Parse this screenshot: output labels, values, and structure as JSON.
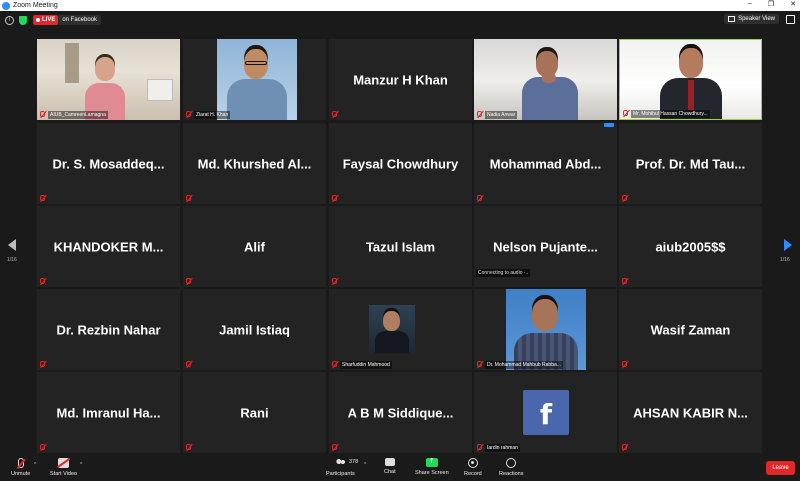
{
  "window": {
    "title": "Zoom Meeting",
    "minimize": "–",
    "maximize": "❐",
    "close": "✕"
  },
  "topbar": {
    "live_label": "LIVE",
    "live_target": "on Facebook",
    "speaker_view": "Speaker View"
  },
  "tiles": [
    {
      "name": "",
      "caption": "AIUB_CamreenLamagna"
    },
    {
      "name": "",
      "caption": "Ziarat H. Khan"
    },
    {
      "name": "Manzur H Khan",
      "caption": ""
    },
    {
      "name": "",
      "caption": "Nadia Anwar"
    },
    {
      "name": "",
      "caption": "Mr. Mohibul Hassan Chowdhury..."
    },
    {
      "name": "Dr. S. Mosaddeq...",
      "caption": ""
    },
    {
      "name": "Md. Khurshed Al...",
      "caption": ""
    },
    {
      "name": "Faysal Chowdhury",
      "caption": ""
    },
    {
      "name": "Mohammad Abd...",
      "caption": ""
    },
    {
      "name": "Prof. Dr. Md Tau...",
      "caption": ""
    },
    {
      "name": "KHANDOKER M...",
      "caption": ""
    },
    {
      "name": "Alif",
      "caption": ""
    },
    {
      "name": "Tazul Islam",
      "caption": ""
    },
    {
      "name": "Nelson Pujante...",
      "caption": ""
    },
    {
      "name": "aiub2005$$",
      "caption": ""
    },
    {
      "name": "Dr. Rezbin Nahar",
      "caption": ""
    },
    {
      "name": "Jamil Istiaq",
      "caption": ""
    },
    {
      "name": "",
      "caption": "Sharfuddin Mahmood"
    },
    {
      "name": "",
      "caption": "Dr. Mohammad Mahbub Rabba..."
    },
    {
      "name": "Wasif Zaman",
      "caption": ""
    },
    {
      "name": "Md. Imranul Ha...",
      "caption": ""
    },
    {
      "name": "Rani",
      "caption": ""
    },
    {
      "name": "A B M Siddique...",
      "caption": ""
    },
    {
      "name": "",
      "caption": "Iardin rahman"
    },
    {
      "name": "AHSAN KABIR N...",
      "caption": ""
    }
  ],
  "connecting_note": "Connecting to audio ·..",
  "tile_menu": "•••",
  "fb_letter": "f",
  "pager": {
    "left": "1/16",
    "right": "1/16"
  },
  "toolbar": {
    "unmute": "Unmute",
    "start_video": "Start Video",
    "participants": "Participants",
    "participant_count": "378",
    "chat": "Chat",
    "share_screen": "Share Screen",
    "record": "Record",
    "reactions": "Reactions",
    "leave": "Leave",
    "caret": "^"
  },
  "colors": {
    "accent": "#2d8cff",
    "live_red": "#e02828",
    "share_green": "#23d959",
    "active_border": "#9bd34a"
  }
}
